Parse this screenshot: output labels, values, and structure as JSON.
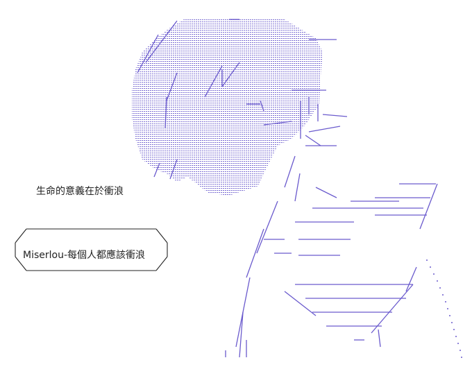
{
  "caption": "生命的意義在於衝浪",
  "speech_bubble": {
    "text": "Miserlou-每個人都應該衝浪"
  },
  "colors": {
    "line_ink": "#6a5acd",
    "text": "#222222",
    "background": "#ffffff"
  }
}
